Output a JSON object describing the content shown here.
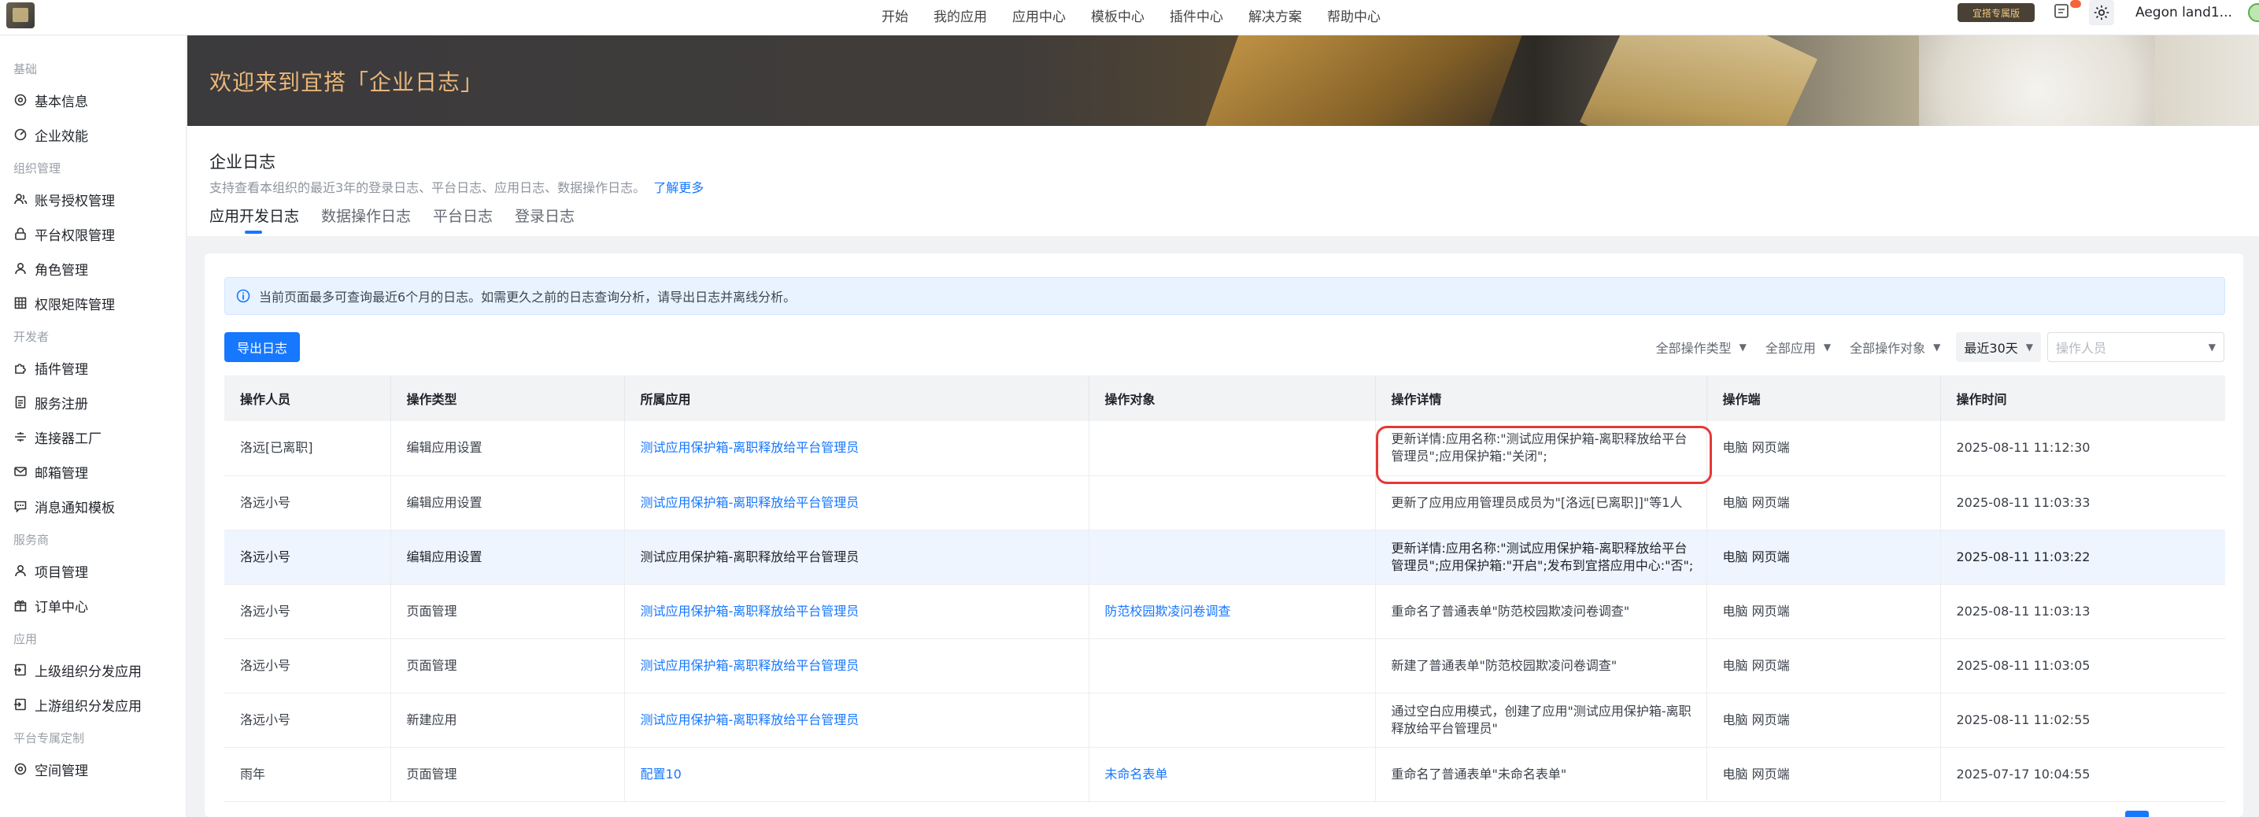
{
  "topnav": [
    "开始",
    "我的应用",
    "应用中心",
    "模板中心",
    "插件中心",
    "解决方案",
    "帮助中心"
  ],
  "topright": {
    "exclusive": "宜搭专属版",
    "user": "Aegon land1..."
  },
  "sidebar": {
    "groups": [
      {
        "label": "基础",
        "items": [
          {
            "label": "基本信息",
            "icon": "gear-icon"
          },
          {
            "label": "企业效能",
            "icon": "chart-icon"
          }
        ]
      },
      {
        "label": "组织管理",
        "items": [
          {
            "label": "账号授权管理",
            "icon": "users-icon"
          },
          {
            "label": "平台权限管理",
            "icon": "lock-icon"
          },
          {
            "label": "角色管理",
            "icon": "user-icon"
          },
          {
            "label": "权限矩阵管理",
            "icon": "grid-icon"
          }
        ]
      },
      {
        "label": "开发者",
        "items": [
          {
            "label": "插件管理",
            "icon": "plugin-icon"
          },
          {
            "label": "服务注册",
            "icon": "doc-icon"
          },
          {
            "label": "连接器工厂",
            "icon": "connector-icon"
          },
          {
            "label": "邮箱管理",
            "icon": "mail-icon"
          },
          {
            "label": "消息通知模板",
            "icon": "message-icon"
          }
        ]
      },
      {
        "label": "服务商",
        "items": [
          {
            "label": "项目管理",
            "icon": "user-icon"
          },
          {
            "label": "订单中心",
            "icon": "gift-icon"
          }
        ]
      },
      {
        "label": "应用",
        "items": [
          {
            "label": "上级组织分发应用",
            "icon": "import-icon"
          },
          {
            "label": "上游组织分发应用",
            "icon": "import-icon"
          }
        ]
      },
      {
        "label": "平台专属定制",
        "items": [
          {
            "label": "空间管理",
            "icon": "gear-icon"
          }
        ]
      }
    ]
  },
  "banner": {
    "title": "欢迎来到宜搭「企业日志」"
  },
  "page": {
    "title": "企业日志",
    "desc": "支持查看本组织的最近3年的登录日志、平台日志、应用日志、数据操作日志。",
    "more": "了解更多",
    "tabs": [
      "应用开发日志",
      "数据操作日志",
      "平台日志",
      "登录日志"
    ]
  },
  "notice": "当前页面最多可查询最近6个月的日志。如需更久之前的日志查询分析，请导出日志并离线分析。",
  "export_label": "导出日志",
  "filters": {
    "type": "全部操作类型",
    "app": "全部应用",
    "object": "全部操作对象",
    "range": "最近30天",
    "operator_placeholder": "操作人员"
  },
  "table": {
    "headers": [
      "操作人员",
      "操作类型",
      "所属应用",
      "操作对象",
      "操作详情",
      "操作端",
      "操作时间"
    ],
    "rows": [
      [
        "洛远[已离职]",
        "编辑应用设置",
        "测试应用保护箱-离职释放给平台管理员",
        "",
        "更新详情:应用名称:\"测试应用保护箱-离职释放给平台管理员\";应用保护箱:\"关闭\";",
        "电脑 网页端",
        "2025-08-11 11:12:30"
      ],
      [
        "洛远小号",
        "编辑应用设置",
        "测试应用保护箱-离职释放给平台管理员",
        "",
        "更新了应用应用管理员成员为\"[洛远[已离职]]\"等1人",
        "电脑 网页端",
        "2025-08-11 11:03:33"
      ],
      [
        "洛远小号",
        "编辑应用设置",
        "测试应用保护箱-离职释放给平台管理员",
        "",
        "更新详情:应用名称:\"测试应用保护箱-离职释放给平台管理员\";应用保护箱:\"开启\";发布到宜搭应用中心:\"否\";",
        "电脑 网页端",
        "2025-08-11 11:03:22"
      ],
      [
        "洛远小号",
        "页面管理",
        "测试应用保护箱-离职释放给平台管理员",
        "防范校园欺凌问卷调查",
        "重命名了普通表单\"防范校园欺凌问卷调查\"",
        "电脑 网页端",
        "2025-08-11 11:03:13"
      ],
      [
        "洛远小号",
        "页面管理",
        "测试应用保护箱-离职释放给平台管理员",
        "",
        "新建了普通表单\"防范校园欺凌问卷调查\"",
        "电脑 网页端",
        "2025-08-11 11:03:05"
      ],
      [
        "洛远小号",
        "新建应用",
        "测试应用保护箱-离职释放给平台管理员",
        "",
        "通过空白应用模式，创建了应用\"测试应用保护箱-离职释放给平台管理员\"",
        "电脑 网页端",
        "2025-08-11 11:02:55"
      ],
      [
        "雨年",
        "页面管理",
        "配置10",
        "未命名表单",
        "重命名了普通表单\"未命名表单\"",
        "电脑 网页端",
        "2025-07-17 10:04:55"
      ]
    ]
  }
}
